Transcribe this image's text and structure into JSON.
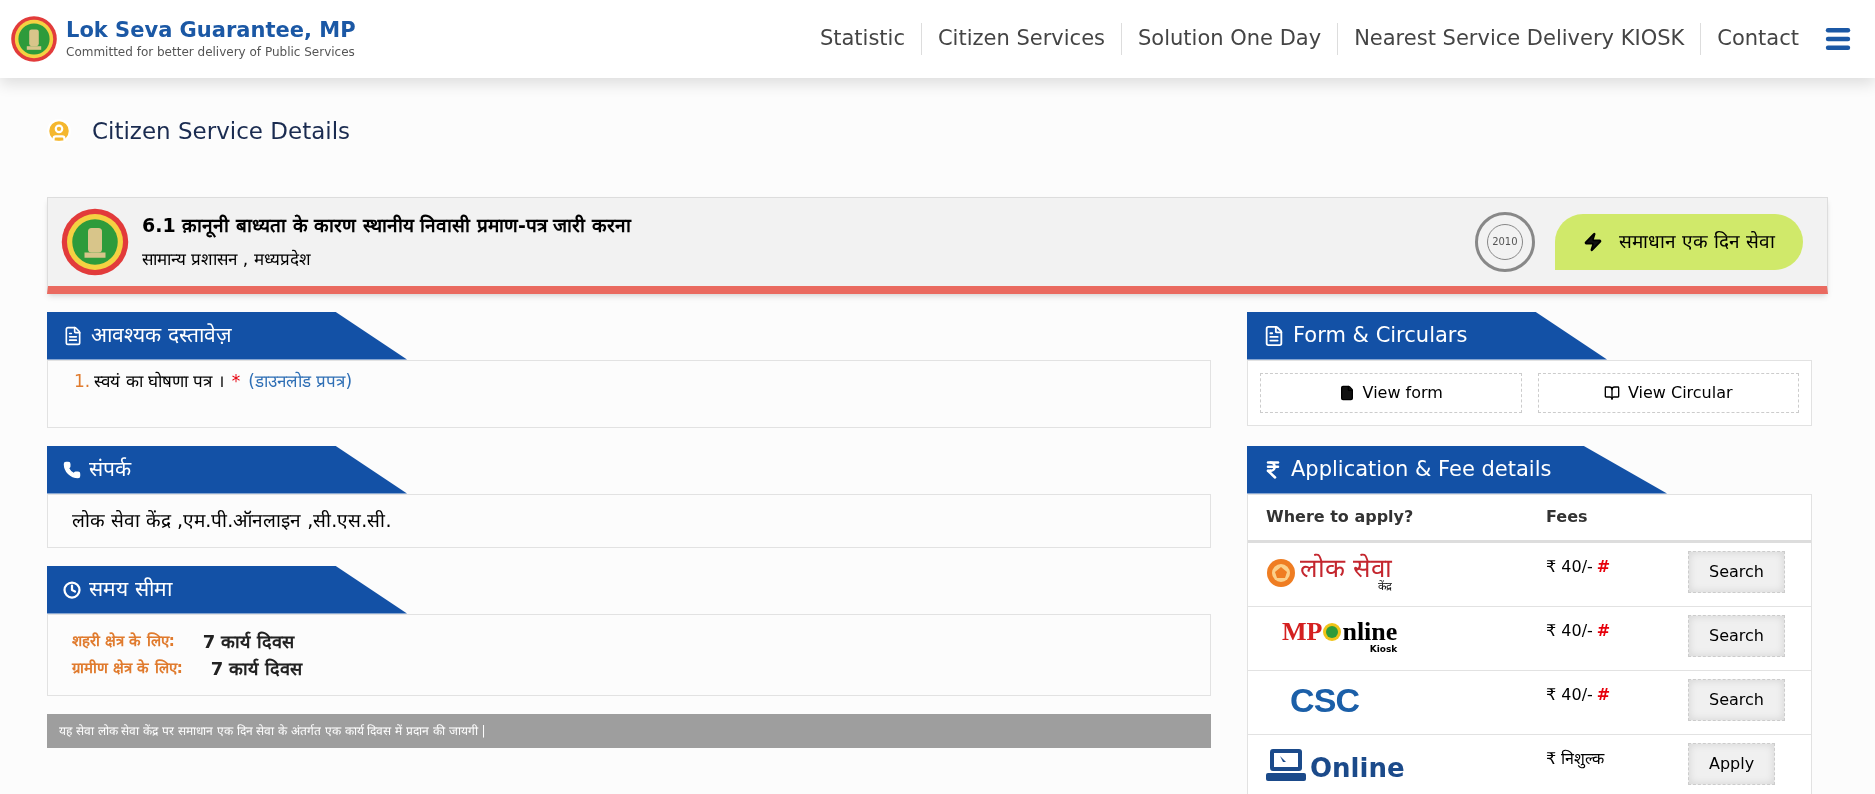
{
  "header": {
    "title": "Lok Seva Guarantee, MP",
    "tagline": "Committed for better delivery of Public Services",
    "nav": [
      "Statistic",
      "Citizen Services",
      "Solution One Day",
      "Nearest Service Delivery KIOSK",
      "Contact"
    ]
  },
  "page_title": "Citizen Service Details",
  "service": {
    "title": "6.1 क़ानूनी बाध्यता के कारण स्थानीय निवासी प्रमाण-पत्र जारी करना",
    "department": "सामान्य प्रशासन , मध्यप्रदेश",
    "seal_text": "2010",
    "badge": "समाधान एक दिन सेवा"
  },
  "documents": {
    "heading": "आवश्यक दस्तावेज़",
    "items": [
      {
        "number": "1.",
        "text": "स्वयं का घोषणा पत्र ।",
        "required_mark": "*",
        "link": "(डाउनलोड प्रपत्र)"
      }
    ]
  },
  "contact": {
    "heading": "संपर्क",
    "text": "लोक सेवा केंद्र ,एम.पी.ऑनलाइन ,सी.एस.सी."
  },
  "time_limit": {
    "heading": "समय सीमा",
    "rows": [
      {
        "label": "शहरी क्षेत्र के लिए:",
        "value": "7 कार्य दिवस"
      },
      {
        "label": "ग्रामीण क्षेत्र के लिए:",
        "value": "7 कार्य दिवस"
      }
    ]
  },
  "note": "यह सेवा लोक सेवा केंद्र पर समाधान एक दिन सेवा के अंतर्गत एक कार्य दिवस में प्रदान की जायगी |",
  "forms": {
    "heading": "Form & Circulars",
    "buttons": [
      {
        "kind": "form",
        "label": "View form"
      },
      {
        "kind": "circular",
        "label": "View Circular"
      }
    ]
  },
  "fees": {
    "heading": "Application & Fee details",
    "columns": [
      "Where to apply?",
      "Fees"
    ],
    "rows": [
      {
        "kind": "lokseva",
        "logo": [
          "लोक सेवा",
          "केंद्र"
        ],
        "fee": "₹ 40/-",
        "mark": "#",
        "action": "Search"
      },
      {
        "kind": "mponline",
        "logo": [
          "MP",
          "nline",
          "Kiosk"
        ],
        "fee": "₹ 40/-",
        "mark": "#",
        "action": "Search"
      },
      {
        "kind": "csc",
        "logo": [
          "CSC"
        ],
        "fee": "₹ 40/-",
        "mark": "#",
        "action": "Search"
      },
      {
        "kind": "online",
        "logo": [
          "Online"
        ],
        "fee": "₹ निशुल्क",
        "action": "Apply"
      }
    ]
  }
}
